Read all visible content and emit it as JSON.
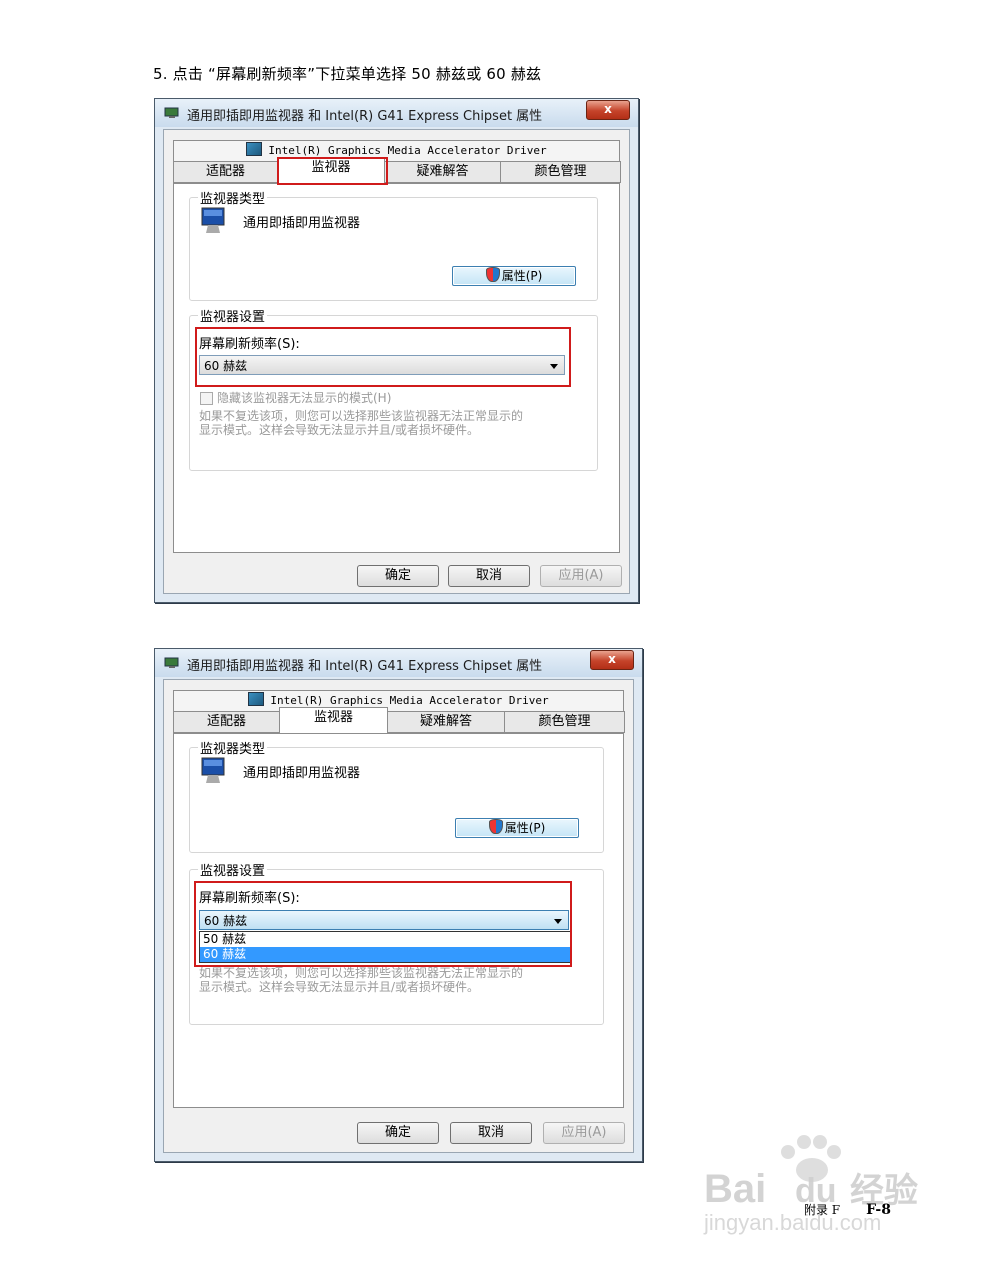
{
  "instruction": "5.  点击 “屏幕刷新频率”下拉菜单选择 50 赫兹或  60 赫兹",
  "dialog": {
    "title": "通用即插即用监视器 和 Intel(R) G41 Express Chipset 属性",
    "close_label": "x",
    "driver_tab": "Intel(R) Graphics Media Accelerator Driver",
    "tabs": [
      "适配器",
      "监视器",
      "疑难解答",
      "颜色管理"
    ],
    "monitor_type_label": "监视器类型",
    "monitor_name": "通用即插即用监视器",
    "properties_button": "属性(P)",
    "monitor_settings_label": "监视器设置",
    "refresh_label": "屏幕刷新频率(S):",
    "refresh_value": "60 赫兹",
    "hide_modes_label": "隐藏该监视器无法显示的模式(H)",
    "hide_modes_desc_1": "如果不复选该项，则您可以选择那些该监视器无法正常显示的",
    "hide_modes_desc_2": "显示模式。这样会导致无法显示并且/或者损坏硬件。",
    "ok_button": "确定",
    "cancel_button": "取消",
    "apply_button": "应用(A)"
  },
  "dropdown_options": [
    "50 赫兹",
    "60 赫兹"
  ],
  "dropdown_selected": "60 赫兹",
  "footer": {
    "appendix": "附录 F",
    "page": "F-8"
  },
  "watermark": {
    "brand": "Bai du 经验",
    "url": "jingyan.baidu.com"
  }
}
